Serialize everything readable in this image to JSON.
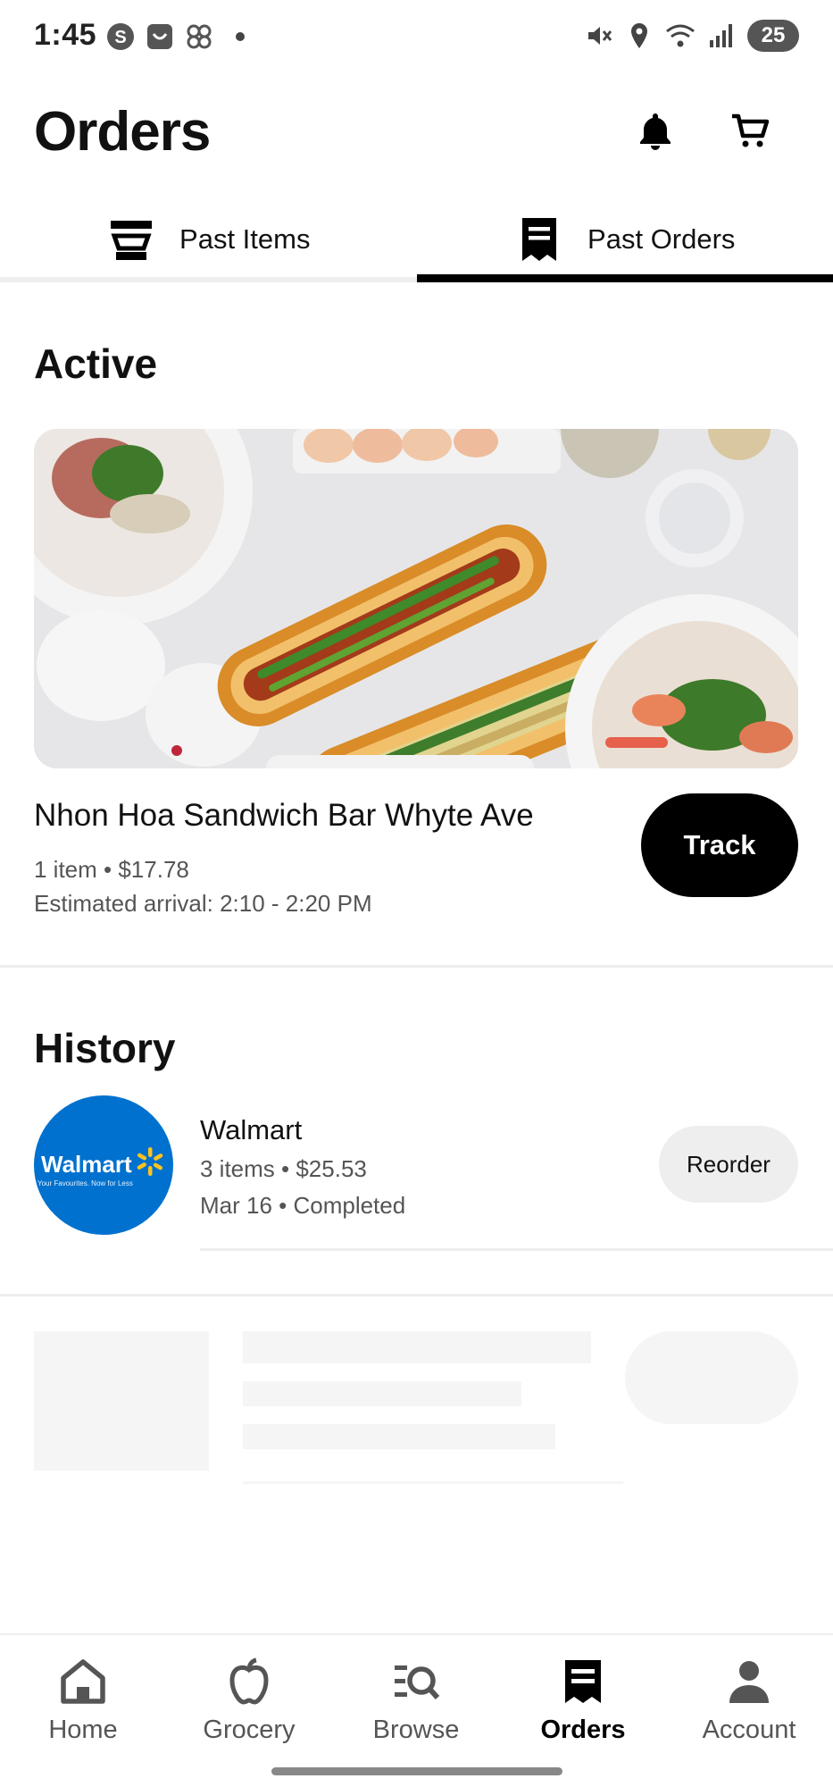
{
  "status_bar": {
    "time": "1:45",
    "battery": "25",
    "left_icons": [
      "s-app-icon",
      "shop-bag-icon",
      "pinwheel-icon"
    ],
    "right_icons": [
      "mute-icon",
      "location-icon",
      "wifi-6e-icon",
      "signal-icon"
    ]
  },
  "header": {
    "title": "Orders",
    "bell_icon": "bell-icon",
    "cart_icon": "cart-icon"
  },
  "tabs": [
    {
      "label": "Past Items",
      "icon": "bowl-icon",
      "active": false
    },
    {
      "label": "Past Orders",
      "icon": "receipt-icon",
      "active": true
    }
  ],
  "active": {
    "section_title": "Active",
    "order": {
      "store_name": "Nhon Hoa Sandwich Bar Whyte Ave",
      "summary": "1 item • $17.78",
      "arrival": "Estimated arrival: 2:10 - 2:20 PM",
      "track_label": "Track"
    }
  },
  "history": {
    "section_title": "History",
    "items": [
      {
        "logo_text": "Walmart",
        "logo_tagline": "Your Favourites. Now for Less",
        "store_name": "Walmart",
        "summary": "3 items • $25.53",
        "status": "Mar 16 • Completed",
        "reorder_label": "Reorder"
      }
    ]
  },
  "bottom_nav": [
    {
      "label": "Home",
      "icon": "home-icon",
      "active": false
    },
    {
      "label": "Grocery",
      "icon": "apple-icon",
      "active": false
    },
    {
      "label": "Browse",
      "icon": "browse-icon",
      "active": false
    },
    {
      "label": "Orders",
      "icon": "receipt-icon",
      "active": true
    },
    {
      "label": "Account",
      "icon": "person-icon",
      "active": false
    }
  ],
  "colors": {
    "accent": "#000000",
    "walmart_blue": "#0071ce",
    "walmart_spark": "#ffc220",
    "muted_text": "#555555",
    "divider": "#eeeeee"
  }
}
